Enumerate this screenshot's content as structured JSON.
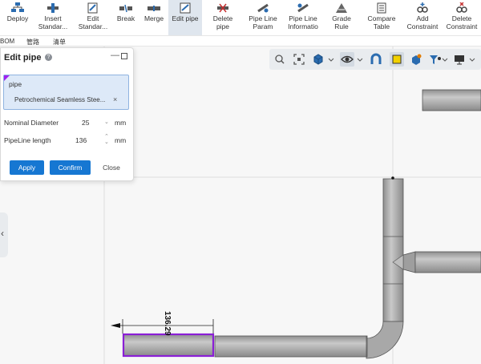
{
  "ribbon": {
    "tools": [
      {
        "id": "deploy",
        "label": "Deploy",
        "icon": "deploy-icon"
      },
      {
        "id": "insert-standard",
        "label": "Insert\nStandar...",
        "icon": "insert-standard-icon"
      },
      {
        "id": "edit-standard",
        "label": "Edit\nStandar...",
        "icon": "edit-standard-icon"
      },
      {
        "id": "break",
        "label": "Break",
        "icon": "break-icon"
      },
      {
        "id": "merge",
        "label": "Merge",
        "icon": "merge-icon"
      },
      {
        "id": "edit-pipe",
        "label": "Edit pipe",
        "icon": "edit-pipe-icon",
        "active": true
      },
      {
        "id": "delete-pipe",
        "label": "Delete\npipe",
        "icon": "delete-pipe-icon"
      },
      {
        "id": "pipe-line-param",
        "label": "Pipe Line\nParam",
        "icon": "pipe-line-param-icon"
      },
      {
        "id": "pipe-line-info",
        "label": "Pipe Line\nInformatio",
        "icon": "pipe-line-info-icon"
      },
      {
        "id": "grade-rule",
        "label": "Grade\nRule",
        "icon": "grade-rule-icon"
      },
      {
        "id": "compare-table",
        "label": "Compare\nTable",
        "icon": "compare-table-icon"
      },
      {
        "id": "add-constraint",
        "label": "Add\nConstraint",
        "icon": "add-constraint-icon"
      },
      {
        "id": "delete-constraint",
        "label": "Delete\nConstraint",
        "icon": "delete-constraint-icon"
      }
    ]
  },
  "subbar": {
    "items": [
      "BOM",
      "管路",
      "清单"
    ]
  },
  "dialog": {
    "title": "Edit pipe",
    "pipe_label": "pipe",
    "pipe_value": "Petrochemical Seamless Stee...",
    "nominal_diameter_label": "Nominal Diameter",
    "nominal_diameter_value": "25",
    "nominal_diameter_unit": "mm",
    "pipeline_length_label": "PipeLine length",
    "pipeline_length_value": "136",
    "pipeline_length_unit": "mm",
    "apply_label": "Apply",
    "confirm_label": "Confirm",
    "close_label": "Close"
  },
  "canvas": {
    "dimension_label": "136.29"
  },
  "colors": {
    "accent": "#1677d2",
    "selection": "#8a1fd6",
    "pipe": "#a9a9a9"
  }
}
